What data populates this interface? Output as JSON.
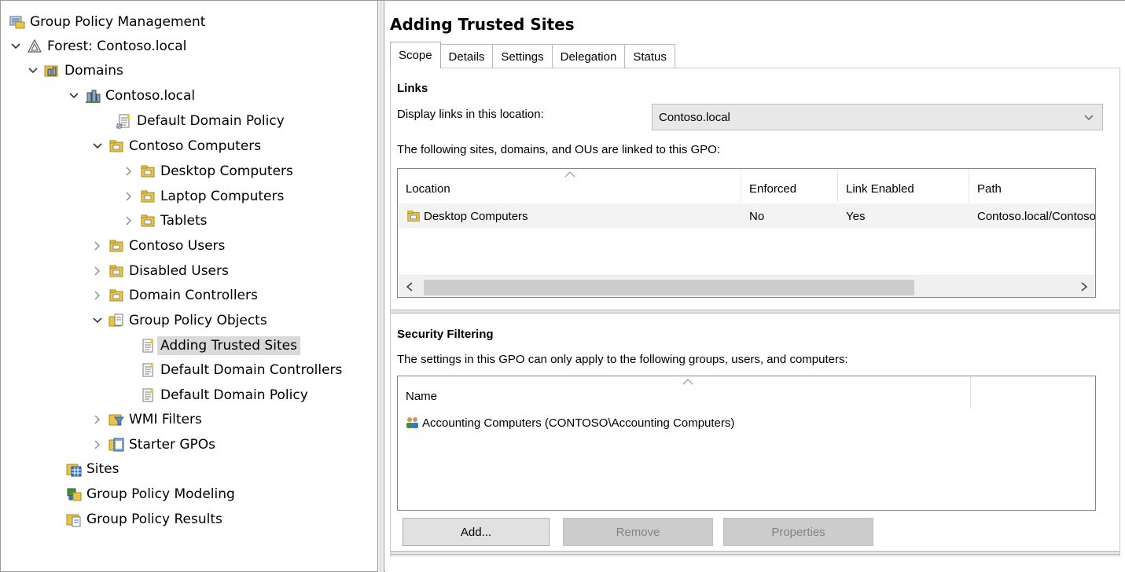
{
  "tree": {
    "root_label": "Group Policy Management",
    "forest_label": "Forest: Contoso.local",
    "domains_label": "Domains",
    "domain_label": "Contoso.local",
    "default_domain_policy_link": "Default Domain Policy",
    "contoso_computers": "Contoso Computers",
    "desktop_computers": "Desktop Computers",
    "laptop_computers": "Laptop Computers",
    "tablets": "Tablets",
    "contoso_users": "Contoso Users",
    "disabled_users": "Disabled Users",
    "domain_controllers": "Domain Controllers",
    "gpo_container": "Group Policy Objects",
    "gpo_adding_trusted_sites": "Adding Trusted Sites",
    "gpo_default_domain_controllers": "Default Domain Controllers",
    "gpo_default_domain_policy": "Default Domain Policy",
    "wmi_filters": "WMI Filters",
    "starter_gpos": "Starter GPOs",
    "sites": "Sites",
    "modeling": "Group Policy Modeling",
    "results": "Group Policy Results"
  },
  "details": {
    "title": "Adding Trusted Sites",
    "tabs": [
      "Scope",
      "Details",
      "Settings",
      "Delegation",
      "Status"
    ],
    "links": {
      "heading": "Links",
      "display_label": "Display links in this location:",
      "location_value": "Contoso.local",
      "linked_text": "The following sites, domains, and OUs are linked to this GPO:",
      "columns": [
        "Location",
        "Enforced",
        "Link Enabled",
        "Path"
      ],
      "rows": [
        {
          "location": "Desktop Computers",
          "enforced": "No",
          "link_enabled": "Yes",
          "path": "Contoso.local/Contoso Computers/Desktop Computers"
        }
      ]
    },
    "security": {
      "heading": "Security Filtering",
      "desc": "The settings in this GPO can only apply to the following groups, users, and computers:",
      "column": "Name",
      "rows": [
        "Accounting Computers (CONTOSO\\Accounting Computers)"
      ],
      "buttons": {
        "add": "Add...",
        "remove": "Remove",
        "properties": "Properties"
      }
    }
  },
  "colors": {
    "selection": "#d9d9d9",
    "disabled_button": "#cccccc",
    "folder": "#e8c44a"
  }
}
